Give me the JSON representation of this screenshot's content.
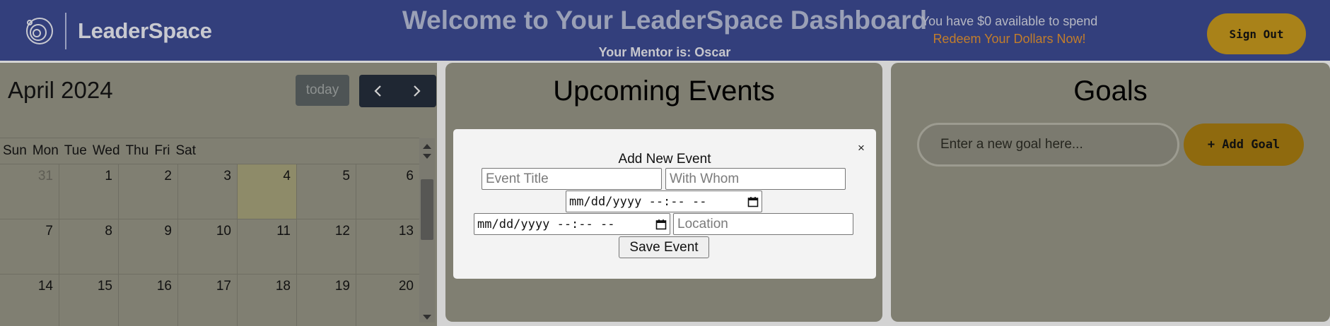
{
  "header": {
    "brand_name": "LeaderSpace",
    "title": "Welcome to Your LeaderSpace Dashboard",
    "mentor_text": "Your Mentor is: Oscar",
    "balance_text": "You have $0 available to spend",
    "redeem_link": "Redeem Your Dollars Now!",
    "signout_label": "Sign Out"
  },
  "calendar": {
    "title": "April 2024",
    "today_label": "today",
    "prev_icon": "chevron-left-icon",
    "next_icon": "chevron-right-icon",
    "days_of_week": [
      "Sun",
      "Mon",
      "Tue",
      "Wed",
      "Thu",
      "Fri",
      "Sat"
    ],
    "weeks": [
      [
        "31",
        "1",
        "2",
        "3",
        "4",
        "5",
        "6"
      ],
      [
        "7",
        "8",
        "9",
        "10",
        "11",
        "12",
        "13"
      ],
      [
        "14",
        "15",
        "16",
        "17",
        "18",
        "19",
        "20"
      ]
    ]
  },
  "events": {
    "title": "Upcoming Events"
  },
  "goals": {
    "title": "Goals",
    "input_placeholder": "Enter a new goal here...",
    "add_label": "+ Add Goal"
  },
  "modal": {
    "title": "Add New Event",
    "close_label": "×",
    "event_title_placeholder": "Event Title",
    "with_whom_placeholder": "With Whom",
    "start_datetime": "mm/dd/yyyy --:-- --",
    "end_datetime": "mm/dd/yyyy --:-- --",
    "location_placeholder": "Location",
    "save_label": "Save Event"
  },
  "colors": {
    "header_bg": "#333f7c",
    "accent_gold": "#a98219",
    "link_orange": "#c27d2b",
    "panel_bg": "#807f72"
  }
}
